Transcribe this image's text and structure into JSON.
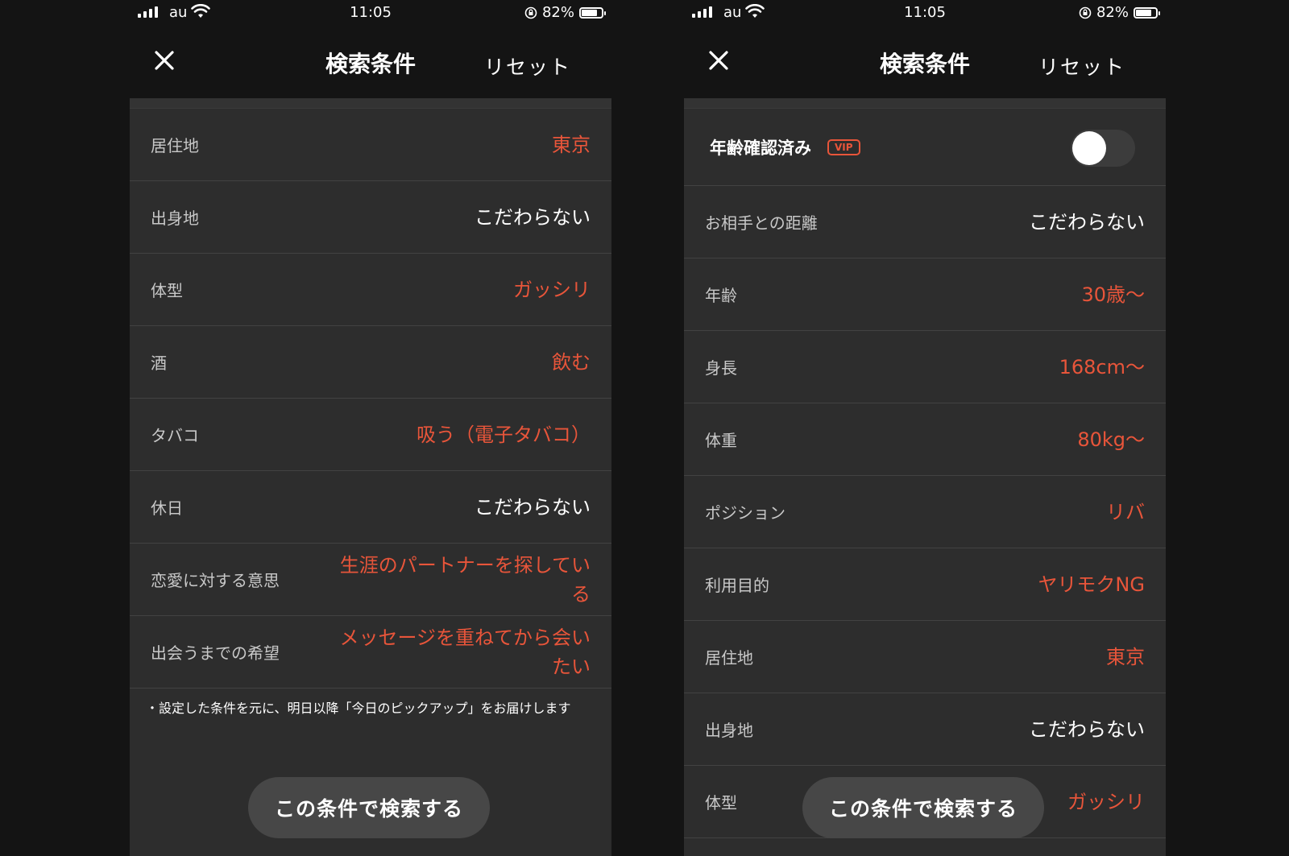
{
  "colors": {
    "accent": "#e8553a",
    "background": "#141414",
    "panel": "#2d2d2d",
    "divider": "#424242",
    "button": "#474747"
  },
  "left": {
    "status": {
      "carrier": "au",
      "time": "11:05",
      "battery": "82%",
      "battery_level": 0.82
    },
    "nav": {
      "close_icon": "close-icon",
      "title": "検索条件",
      "reset": "リセット"
    },
    "rows": [
      {
        "label": "居住地",
        "value": "東京",
        "accent": true
      },
      {
        "label": "出身地",
        "value": "こだわらない",
        "accent": false
      },
      {
        "label": "体型",
        "value": "ガッシリ",
        "accent": true
      },
      {
        "label": "酒",
        "value": "飲む",
        "accent": true
      },
      {
        "label": "タバコ",
        "value": "吸う（電子タバコ）",
        "accent": true
      },
      {
        "label": "休日",
        "value": "こだわらない",
        "accent": false
      },
      {
        "label": "恋愛に対する意思",
        "value": "生涯のパートナーを探している",
        "accent": true
      },
      {
        "label": "出会うまでの希望",
        "value": "メッセージを重ねてから会いたい",
        "accent": true
      }
    ],
    "note": "・設定した条件を元に、明日以降「今日のピックアップ」をお届けします",
    "search_button": "この条件で検索する"
  },
  "right": {
    "status": {
      "carrier": "au",
      "time": "11:05",
      "battery": "82%",
      "battery_level": 0.82
    },
    "nav": {
      "close_icon": "close-icon",
      "title": "検索条件",
      "reset": "リセット"
    },
    "age_verified": {
      "label": "年齢確認済み",
      "badge": "VIP",
      "toggle_on": false
    },
    "rows": [
      {
        "label": "お相手との距離",
        "value": "こだわらない",
        "accent": false
      },
      {
        "label": "年齢",
        "value": "30歳〜",
        "accent": true
      },
      {
        "label": "身長",
        "value": "168cm〜",
        "accent": true
      },
      {
        "label": "体重",
        "value": "80kg〜",
        "accent": true
      },
      {
        "label": "ポジション",
        "value": "リバ",
        "accent": true
      },
      {
        "label": "利用目的",
        "value": "ヤリモクNG",
        "accent": true
      },
      {
        "label": "居住地",
        "value": "東京",
        "accent": true
      },
      {
        "label": "出身地",
        "value": "こだわらない",
        "accent": false
      },
      {
        "label": "体型",
        "value": "ガッシリ",
        "accent": true
      }
    ],
    "search_button": "この条件で検索する"
  }
}
